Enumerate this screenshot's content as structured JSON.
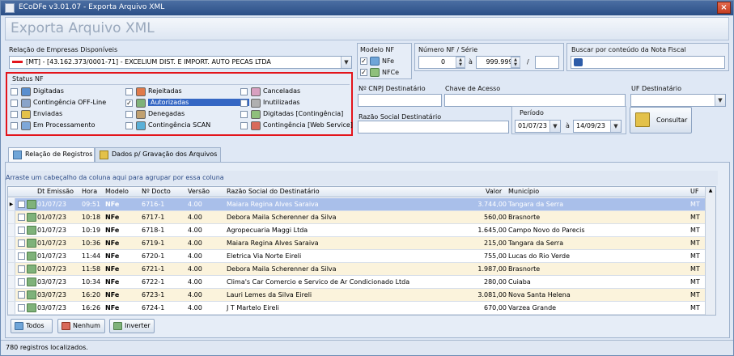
{
  "window": {
    "title": "ECoDFe v3.01.07 - Exporta Arquivo XML",
    "close_label": "×"
  },
  "header": {
    "page_title": "Exporta Arquivo XML"
  },
  "empresas": {
    "label": "Relação de Empresas Disponíveis",
    "selected": "[MT] - [43.162.373/0001-71] - EXCELIUM DIST. E IMPORT. AUTO PECAS LTDA"
  },
  "modelo_nf": {
    "label": "Modelo NF",
    "nfe": "NFe",
    "nfce": "NFCe",
    "nfe_checked": true,
    "nfce_checked": true
  },
  "numero_nf": {
    "label": "Número NF / Série",
    "from": "0",
    "sep": "à",
    "to": "999.999",
    "slash": "/",
    "serie": ""
  },
  "busca": {
    "label": "Buscar por conteúdo da Nota Fiscal",
    "value": ""
  },
  "status_nf": {
    "label": "Status NF",
    "items": [
      {
        "label": "Digitadas",
        "checked": false,
        "icon": "pencil-doc-icon"
      },
      {
        "label": "Contingência OFF-Line",
        "checked": false,
        "icon": "offline-doc-icon"
      },
      {
        "label": "Enviadas",
        "checked": false,
        "icon": "sent-doc-icon"
      },
      {
        "label": "Em Processamento",
        "checked": false,
        "icon": "processing-icon"
      },
      {
        "label": "Rejeitadas",
        "checked": false,
        "icon": "rejected-doc-icon"
      },
      {
        "label": "Autorizadas",
        "checked": true,
        "icon": "authorized-doc-icon"
      },
      {
        "label": "Denegadas",
        "checked": false,
        "icon": "denied-doc-icon"
      },
      {
        "label": "Contingência SCAN",
        "checked": false,
        "icon": "scan-globe-icon"
      },
      {
        "label": "Canceladas",
        "checked": false,
        "icon": "cancelled-doc-icon"
      },
      {
        "label": "Inutilizadas",
        "checked": false,
        "icon": "unused-doc-icon"
      },
      {
        "label": "Digitadas [Contingência]",
        "checked": false,
        "icon": "contingency-doc-icon"
      },
      {
        "label": "Contingência [Web Service]",
        "checked": false,
        "icon": "webservice-icon"
      }
    ]
  },
  "filters": {
    "cnpj_label": "Nº CNPJ Destinatário",
    "chave_label": "Chave de Acesso",
    "uf_label": "UF Destinatário",
    "razao_label": "Razão Social Destinatário",
    "periodo_label": "Período",
    "periodo_from": "01/07/23",
    "periodo_sep": "à",
    "periodo_to": "14/09/23",
    "consultar_label": "Consultar"
  },
  "tabs": [
    {
      "label": "Relação de Registros"
    },
    {
      "label": "Dados p/ Gravação dos Arquivos"
    }
  ],
  "grid": {
    "group_hint": "Arraste um cabeçalho da coluna aqui para agrupar por essa coluna",
    "columns": [
      "Dt Emissão",
      "Hora",
      "Modelo",
      "Nº Docto",
      "Versão",
      "Razão Social do Destinatário",
      "Valor",
      "Município",
      "UF"
    ],
    "rows": [
      [
        "01/07/23",
        "09:51",
        "NFe",
        "6716-1",
        "4.00",
        "Maiara Regina Alves Saraiva",
        "3.744,00",
        "Tangara da Serra",
        "MT"
      ],
      [
        "01/07/23",
        "10:18",
        "NFe",
        "6717-1",
        "4.00",
        "Debora Maila Scherenner da Silva",
        "560,00",
        "Brasnorte",
        "MT"
      ],
      [
        "01/07/23",
        "10:19",
        "NFe",
        "6718-1",
        "4.00",
        "Agropecuaria Maggi Ltda",
        "1.645,00",
        "Campo Novo do Parecis",
        "MT"
      ],
      [
        "01/07/23",
        "10:36",
        "NFe",
        "6719-1",
        "4.00",
        "Maiara Regina Alves Saraiva",
        "215,00",
        "Tangara da Serra",
        "MT"
      ],
      [
        "01/07/23",
        "11:44",
        "NFe",
        "6720-1",
        "4.00",
        "Eletrica Via Norte Eireli",
        "755,00",
        "Lucas do Rio Verde",
        "MT"
      ],
      [
        "01/07/23",
        "11:58",
        "NFe",
        "6721-1",
        "4.00",
        "Debora Maila Scherenner da Silva",
        "1.987,00",
        "Brasnorte",
        "MT"
      ],
      [
        "03/07/23",
        "10:34",
        "NFe",
        "6722-1",
        "4.00",
        "Clima's Car Comercio e Servico de Ar Condicionado Ltda",
        "280,00",
        "Cuiaba",
        "MT"
      ],
      [
        "03/07/23",
        "16:20",
        "NFe",
        "6723-1",
        "4.00",
        "Lauri Lemes da Silva Eireli",
        "3.081,00",
        "Nova Santa Helena",
        "MT"
      ],
      [
        "03/07/23",
        "16:26",
        "NFe",
        "6724-1",
        "4.00",
        "J T Martelo Eireli",
        "670,00",
        "Varzea Grande",
        "MT"
      ]
    ]
  },
  "buttons": {
    "todos": "Todos",
    "nenhum": "Nenhum",
    "inverter": "Inverter"
  },
  "statusbar": {
    "text": "780 registros localizados."
  },
  "colors": {
    "highlight": "#e3141b",
    "selection": "#3567c4",
    "row_alt": "#fbf3dc"
  }
}
